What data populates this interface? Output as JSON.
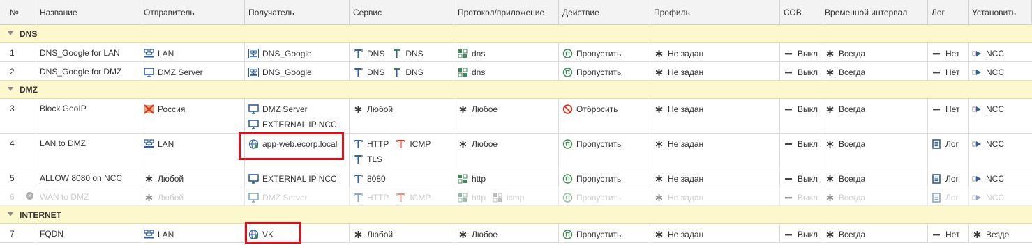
{
  "columns": {
    "num": "№",
    "name": "Название",
    "from": "Отправитель",
    "to": "Получатель",
    "service": "Сервис",
    "protocol": "Протокол/приложение",
    "action": "Действие",
    "profile": "Профиль",
    "cob": "СОВ",
    "time": "Временной интервал",
    "log": "Лог",
    "install": "Установить"
  },
  "groups": {
    "dns": "DNS",
    "dmz": "DMZ",
    "internet": "INTERNET"
  },
  "rows": [
    {
      "num": "1",
      "name": "DNS_Google for LAN",
      "from": [
        "LAN"
      ],
      "to": [
        "DNS_Google"
      ],
      "service": [
        "DNS",
        "DNS"
      ],
      "protocol": [
        "dns"
      ],
      "action": "Пропустить",
      "profile": "Не задан",
      "cob": "Выкл",
      "time": "Всегда",
      "log": "Нет",
      "install": "NCC"
    },
    {
      "num": "2",
      "name": "DNS_Google for DMZ",
      "from": [
        "DMZ Server"
      ],
      "to": [
        "DNS_Google"
      ],
      "service": [
        "DNS",
        "DNS"
      ],
      "protocol": [
        "dns"
      ],
      "action": "Пропустить",
      "profile": "Не задан",
      "cob": "Выкл",
      "time": "Всегда",
      "log": "Нет",
      "install": "NCC"
    },
    {
      "num": "3",
      "name": "Block GeoIP",
      "from": [
        "Россия"
      ],
      "to": [
        "DMZ Server",
        "EXTERNAL IP NCC"
      ],
      "service": [
        "Любой"
      ],
      "protocol": [
        "Любое"
      ],
      "action": "Отбросить",
      "profile": "Не задан",
      "cob": "Выкл",
      "time": "Всегда",
      "log": "Нет",
      "install": "NCC"
    },
    {
      "num": "4",
      "name": "LAN to DMZ",
      "from": [
        "LAN"
      ],
      "to": [
        "app-web.ecorp.local"
      ],
      "service": [
        "HTTP",
        "ICMP",
        "TLS"
      ],
      "protocol": [
        "Любое"
      ],
      "action": "Пропустить",
      "profile": "Не задан",
      "cob": "Выкл",
      "time": "Всегда",
      "log": "Лог",
      "install": "NCC"
    },
    {
      "num": "5",
      "name": "ALLOW 8080 on NCC",
      "from": [
        "Любой"
      ],
      "to": [
        "EXTERNAL IP NCC"
      ],
      "service": [
        "8080"
      ],
      "protocol": [
        "http"
      ],
      "action": "Пропустить",
      "profile": "Не задан",
      "cob": "Выкл",
      "time": "Всегда",
      "log": "Лог",
      "install": "NCC"
    },
    {
      "num": "6",
      "name": "WAN to DMZ",
      "from": [
        "Любой"
      ],
      "to": [
        "DMZ Server"
      ],
      "service": [
        "HTTP",
        "ICMP"
      ],
      "protocol": [
        "http",
        "icmp"
      ],
      "action": "Пропустить",
      "profile": "Не задан",
      "cob": "Выкл",
      "time": "Всегда",
      "log": "Лог",
      "install": "NCC"
    },
    {
      "num": "7",
      "name": "FQDN",
      "from": [
        "LAN"
      ],
      "to": [
        "VK"
      ],
      "service": [
        "Любой"
      ],
      "protocol": [
        "Любое"
      ],
      "action": "Пропустить",
      "profile": "Не задан",
      "cob": "Выкл",
      "time": "Всегда",
      "log": "Нет",
      "install": "Везде"
    }
  ],
  "colors": {
    "group_bg": "#fdf7cd",
    "header_bg": "#f3f3f3",
    "highlight": "#e0101a",
    "icon_blue": "#2f5f9e",
    "icon_green": "#3c8a55",
    "icon_red": "#d8341f"
  }
}
